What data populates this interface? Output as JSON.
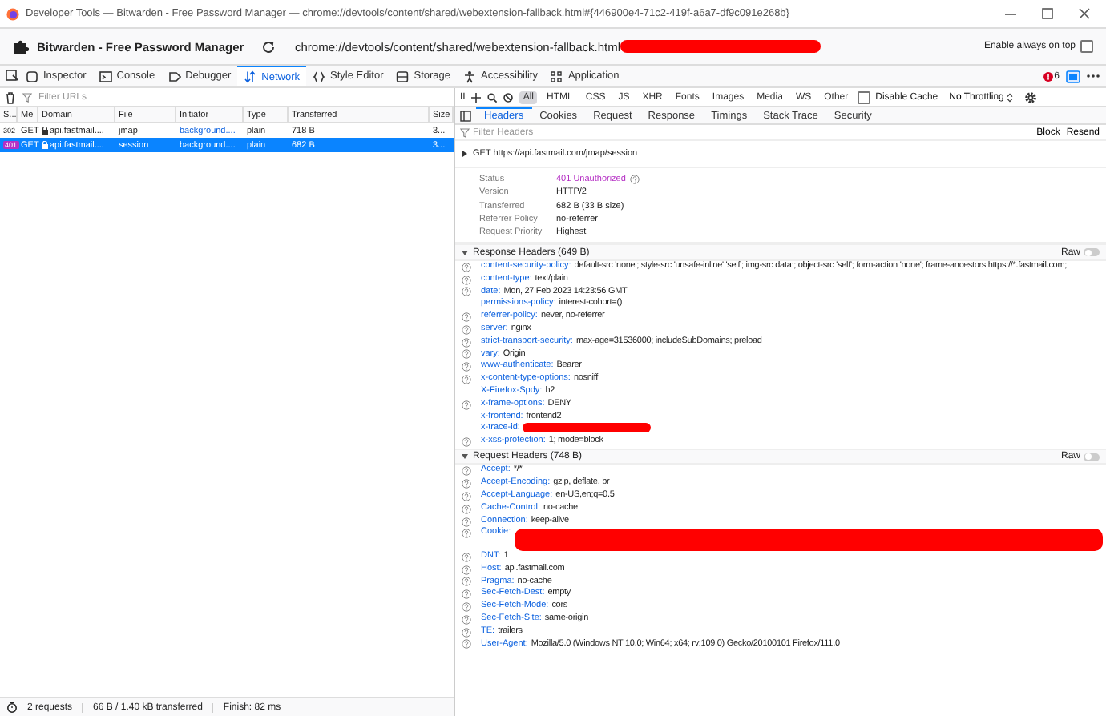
{
  "window": {
    "title": "Developer Tools — Bitwarden - Free Password Manager — chrome://devtools/content/shared/webextension-fallback.html#{446900e4-71c2-419f-a6a7-df9c091e268b}"
  },
  "extension_bar": {
    "title": "Bitwarden - Free Password Manager",
    "url": "chrome://devtools/content/shared/webextension-fallback.html",
    "always_on_top": {
      "label": "Enable always on top",
      "checked": false
    }
  },
  "tools": [
    {
      "kind": "inspector",
      "label": "Inspector",
      "selected": false
    },
    {
      "kind": "console",
      "label": "Console",
      "selected": false
    },
    {
      "kind": "debugger",
      "label": "Debugger",
      "selected": false
    },
    {
      "kind": "network",
      "label": "Network",
      "selected": true
    },
    {
      "kind": "style",
      "label": "Style Editor",
      "selected": false
    },
    {
      "kind": "storage",
      "label": "Storage",
      "selected": false
    },
    {
      "kind": "accessibility",
      "label": "Accessibility",
      "selected": false
    },
    {
      "kind": "application",
      "label": "Application",
      "selected": false
    }
  ],
  "error_count": "6",
  "filter": {
    "placeholder": "Filter URLs"
  },
  "pause_label": "II",
  "type_filters": [
    {
      "label": "All",
      "selected": true
    },
    {
      "label": "HTML",
      "selected": false
    },
    {
      "label": "CSS",
      "selected": false
    },
    {
      "label": "JS",
      "selected": false
    },
    {
      "label": "XHR",
      "selected": false
    },
    {
      "label": "Fonts",
      "selected": false
    },
    {
      "label": "Images",
      "selected": false
    },
    {
      "label": "Media",
      "selected": false
    },
    {
      "label": "WS",
      "selected": false
    },
    {
      "label": "Other",
      "selected": false
    }
  ],
  "disable_cache": {
    "label": "Disable Cache",
    "checked": false
  },
  "throttling": "No Throttling",
  "requests": {
    "columns": [
      "S...",
      "Me",
      "Domain",
      "File",
      "Initiator",
      "Type",
      "Transferred",
      "Size"
    ],
    "rows": [
      {
        "status": "302",
        "method": "GET",
        "domain": "api.fastmail....",
        "file": "jmap",
        "initiator": "background....",
        "type": "plain",
        "transferred": "718 B",
        "size": "3...",
        "selected": false,
        "error": false
      },
      {
        "status": "401",
        "method": "GET",
        "domain": "api.fastmail....",
        "file": "session",
        "initiator": "background....",
        "type": "plain",
        "transferred": "682 B",
        "size": "3...",
        "selected": true,
        "error": true
      }
    ]
  },
  "detail_tabs": [
    {
      "label": "Headers",
      "selected": true
    },
    {
      "label": "Cookies",
      "selected": false
    },
    {
      "label": "Request",
      "selected": false
    },
    {
      "label": "Response",
      "selected": false
    },
    {
      "label": "Timings",
      "selected": false
    },
    {
      "label": "Stack Trace",
      "selected": false
    },
    {
      "label": "Security",
      "selected": false
    }
  ],
  "header_filter": {
    "placeholder": "Filter Headers"
  },
  "block": "Block",
  "resend": "Resend",
  "request_line": "GET https://api.fastmail.com/jmap/session",
  "summary": [
    {
      "name": "Status",
      "value": "401 Unauthorized",
      "kind": "status"
    },
    {
      "name": "Version",
      "value": "HTTP/2",
      "kind": "text"
    },
    {
      "name": "Transferred",
      "value": "682 B (33 B size)",
      "kind": "text"
    },
    {
      "name": "Referrer Policy",
      "value": "no-referrer",
      "kind": "text"
    },
    {
      "name": "Request Priority",
      "value": "Highest",
      "kind": "text"
    }
  ],
  "response_headers": {
    "title": "Response Headers (649 B)",
    "raw": "Raw",
    "raw_on": false,
    "expanded": true,
    "headers": [
      {
        "kind": "text",
        "name": "content-security-policy:",
        "value": "default-src 'none'; style-src 'unsafe-inline' 'self'; img-src data:; object-src 'self'; form-action 'none'; frame-ancestors https://*.fastmail.com;",
        "help": true
      },
      {
        "kind": "text",
        "name": "content-type:",
        "value": "text/plain",
        "help": true
      },
      {
        "kind": "text",
        "name": "date:",
        "value": "Mon, 27 Feb 2023 14:23:56 GMT",
        "help": true
      },
      {
        "kind": "text",
        "name": "permissions-policy:",
        "value": "interest-cohort=()",
        "help": false
      },
      {
        "kind": "text",
        "name": "referrer-policy:",
        "value": "never, no-referrer",
        "help": true
      },
      {
        "kind": "text",
        "name": "server:",
        "value": "nginx",
        "help": true
      },
      {
        "kind": "text",
        "name": "strict-transport-security:",
        "value": "max-age=31536000; includeSubDomains; preload",
        "help": true
      },
      {
        "kind": "text",
        "name": "vary:",
        "value": "Origin",
        "help": true
      },
      {
        "kind": "text",
        "name": "www-authenticate:",
        "value": "Bearer",
        "help": true
      },
      {
        "kind": "text",
        "name": "x-content-type-options:",
        "value": "nosniff",
        "help": true
      },
      {
        "kind": "text",
        "name": "X-Firefox-Spdy:",
        "value": "h2",
        "help": false
      },
      {
        "kind": "text",
        "name": "x-frame-options:",
        "value": "DENY",
        "help": true
      },
      {
        "kind": "text",
        "name": "x-frontend:",
        "value": "frontend2",
        "help": false
      },
      {
        "kind": "redacted",
        "name": "x-trace-id:",
        "help": false
      },
      {
        "kind": "text",
        "name": "x-xss-protection:",
        "value": "1; mode=block",
        "help": true
      }
    ]
  },
  "request_headers": {
    "title": "Request Headers (748 B)",
    "raw": "Raw",
    "raw_on": false,
    "expanded": true,
    "headers": [
      {
        "kind": "text",
        "name": "Accept:",
        "value": "*/*",
        "help": true
      },
      {
        "kind": "text",
        "name": "Accept-Encoding:",
        "value": "gzip, deflate, br",
        "help": true
      },
      {
        "kind": "text",
        "name": "Accept-Language:",
        "value": "en-US,en;q=0.5",
        "help": true
      },
      {
        "kind": "text",
        "name": "Cache-Control:",
        "value": "no-cache",
        "help": true
      },
      {
        "kind": "text",
        "name": "Connection:",
        "value": "keep-alive",
        "help": true
      },
      {
        "kind": "redacted_wrapped",
        "name": "Cookie:",
        "help": true
      },
      {
        "kind": "text",
        "name": "DNT:",
        "value": "1",
        "help": true
      },
      {
        "kind": "text",
        "name": "Host:",
        "value": "api.fastmail.com",
        "help": true
      },
      {
        "kind": "text",
        "name": "Pragma:",
        "value": "no-cache",
        "help": true
      },
      {
        "kind": "text",
        "name": "Sec-Fetch-Dest:",
        "value": "empty",
        "help": true
      },
      {
        "kind": "text",
        "name": "Sec-Fetch-Mode:",
        "value": "cors",
        "help": true
      },
      {
        "kind": "text",
        "name": "Sec-Fetch-Site:",
        "value": "same-origin",
        "help": true
      },
      {
        "kind": "text",
        "name": "TE:",
        "value": "trailers",
        "help": true
      },
      {
        "kind": "text",
        "name": "User-Agent:",
        "value": "Mozilla/5.0 (Windows NT 10.0; Win64; x64; rv:109.0) Gecko/20100101 Firefox/111.0",
        "help": true
      }
    ]
  },
  "status_bar": [
    "2 requests",
    "66 B / 1.40 kB transferred",
    "Finish: 82 ms"
  ]
}
